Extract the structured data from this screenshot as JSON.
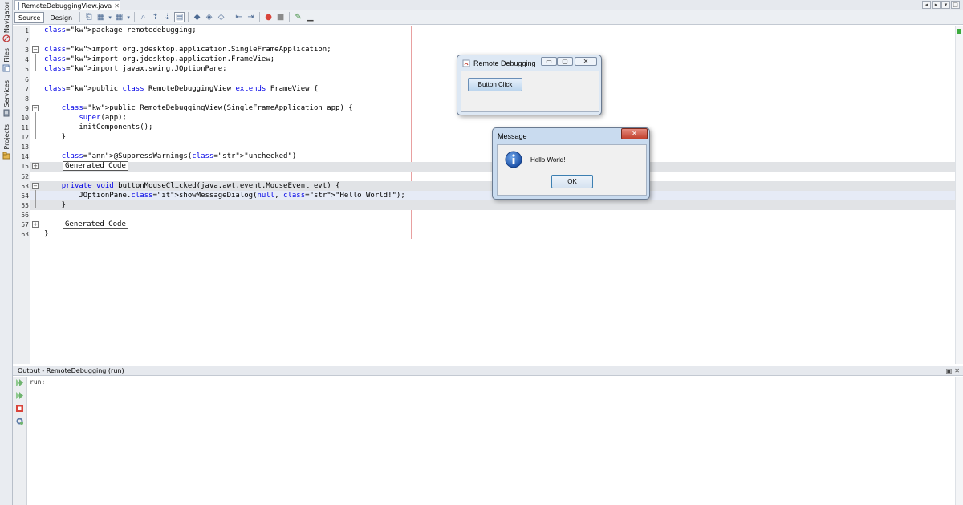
{
  "sidebar": {
    "tabs": [
      {
        "label": "Navigator",
        "icon": "navigator-icon"
      },
      {
        "label": "Files",
        "icon": "files-icon"
      },
      {
        "label": "Services",
        "icon": "services-icon"
      },
      {
        "label": "Projects",
        "icon": "projects-icon"
      }
    ]
  },
  "editor_tab": {
    "filename": "RemoteDebuggingView.java",
    "close": "✕"
  },
  "toolbar": {
    "source_label": "Source",
    "design_label": "Design"
  },
  "code": {
    "lines": [
      {
        "num": "1",
        "text": "package remotedebugging;"
      },
      {
        "num": "2",
        "text": ""
      },
      {
        "num": "3",
        "text": "import org.jdesktop.application.SingleFrameApplication;"
      },
      {
        "num": "4",
        "text": "import org.jdesktop.application.FrameView;"
      },
      {
        "num": "5",
        "text": "import javax.swing.JOptionPane;"
      },
      {
        "num": "6",
        "text": ""
      },
      {
        "num": "7",
        "text": "public class RemoteDebuggingView extends FrameView {"
      },
      {
        "num": "8",
        "text": ""
      },
      {
        "num": "9",
        "text": "    public RemoteDebuggingView(SingleFrameApplication app) {"
      },
      {
        "num": "10",
        "text": "        super(app);"
      },
      {
        "num": "11",
        "text": "        initComponents();"
      },
      {
        "num": "12",
        "text": "    }"
      },
      {
        "num": "13",
        "text": ""
      },
      {
        "num": "14",
        "text": "    @SuppressWarnings(\"unchecked\")"
      },
      {
        "num": "15",
        "text": "Generated Code"
      },
      {
        "num": "52",
        "text": ""
      },
      {
        "num": "53",
        "text": "    private void buttonMouseClicked(java.awt.event.MouseEvent evt) {"
      },
      {
        "num": "54",
        "text": "        JOptionPane.showMessageDialog(null, \"Hello World!\");"
      },
      {
        "num": "55",
        "text": "    }"
      },
      {
        "num": "56",
        "text": ""
      },
      {
        "num": "57",
        "text": "Generated Code"
      },
      {
        "num": "63",
        "text": "}"
      }
    ]
  },
  "output": {
    "title": "Output - RemoteDebugging (run)",
    "text": "run:"
  },
  "app_window": {
    "title": "Remote Debugging",
    "button_label": "Button Click"
  },
  "message_dialog": {
    "title": "Message",
    "message": "Hello World!",
    "ok_label": "OK"
  },
  "colors": {
    "keyword": "#0000e6",
    "string": "#ce7b00",
    "run_green": "#3dab3d",
    "stop_red": "#d9453b"
  }
}
